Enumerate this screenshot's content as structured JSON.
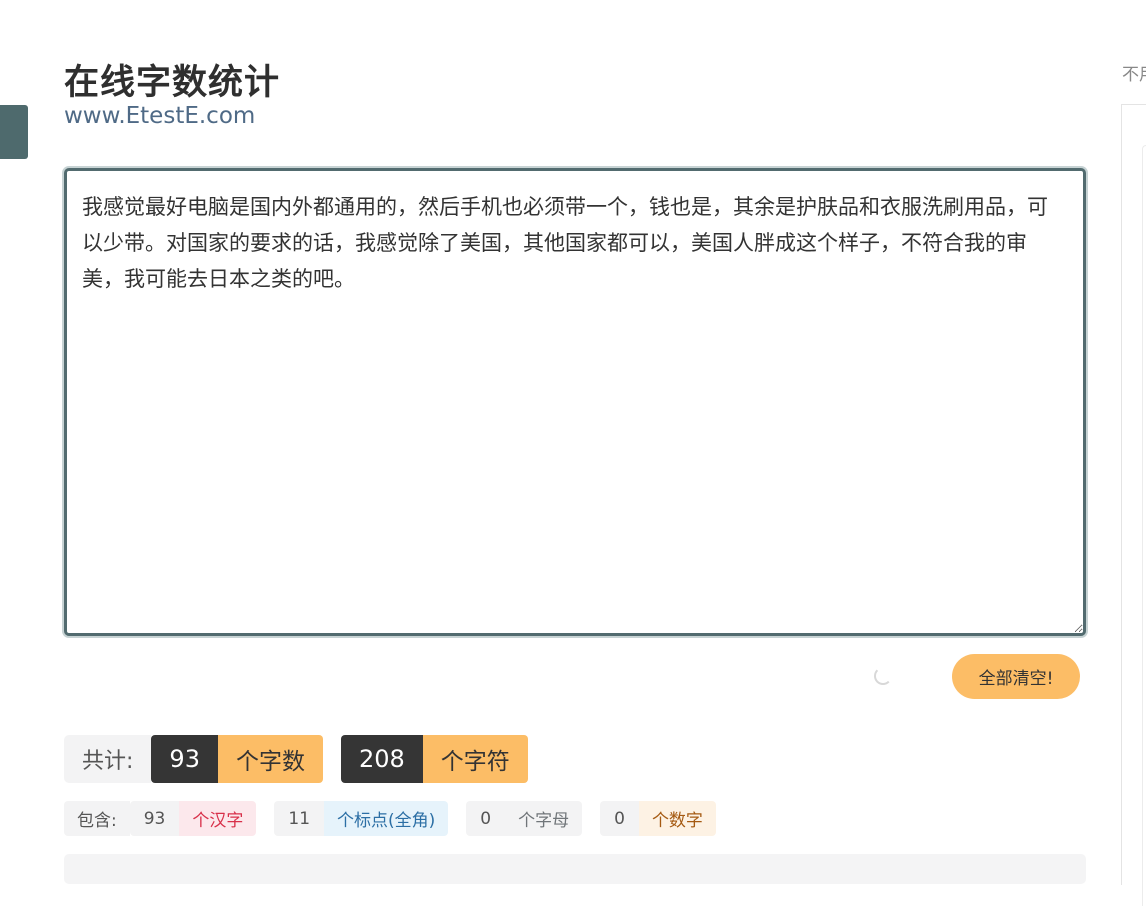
{
  "header": {
    "title": "在线字数统计",
    "subtitle": "www.EtestE.com"
  },
  "sidebar_right": {
    "text": "不用"
  },
  "editor": {
    "content": "我感觉最好电脑是国内外都通用的，然后手机也必须带一个，钱也是，其余是护肤品和衣服洗刷用品，可以少带。对国家的要求的话，我感觉除了美国，其他国家都可以，美国人胖成这个样子，不符合我的审美，我可能去日本之类的吧。"
  },
  "actions": {
    "clear_label": "全部清空!"
  },
  "totals": {
    "label": "共计:",
    "word_count": "93",
    "word_unit": "个字数",
    "char_count": "208",
    "char_unit": "个字符"
  },
  "details": {
    "label": "包含:",
    "items": [
      {
        "count": "93",
        "unit": "个汉字"
      },
      {
        "count": "11",
        "unit": "个标点(全角)"
      },
      {
        "count": "0",
        "unit": "个字母"
      },
      {
        "count": "0",
        "unit": "个数字"
      }
    ]
  },
  "colors": {
    "accent": "#fcbd66",
    "dark": "#353535",
    "border": "#526b6f"
  }
}
